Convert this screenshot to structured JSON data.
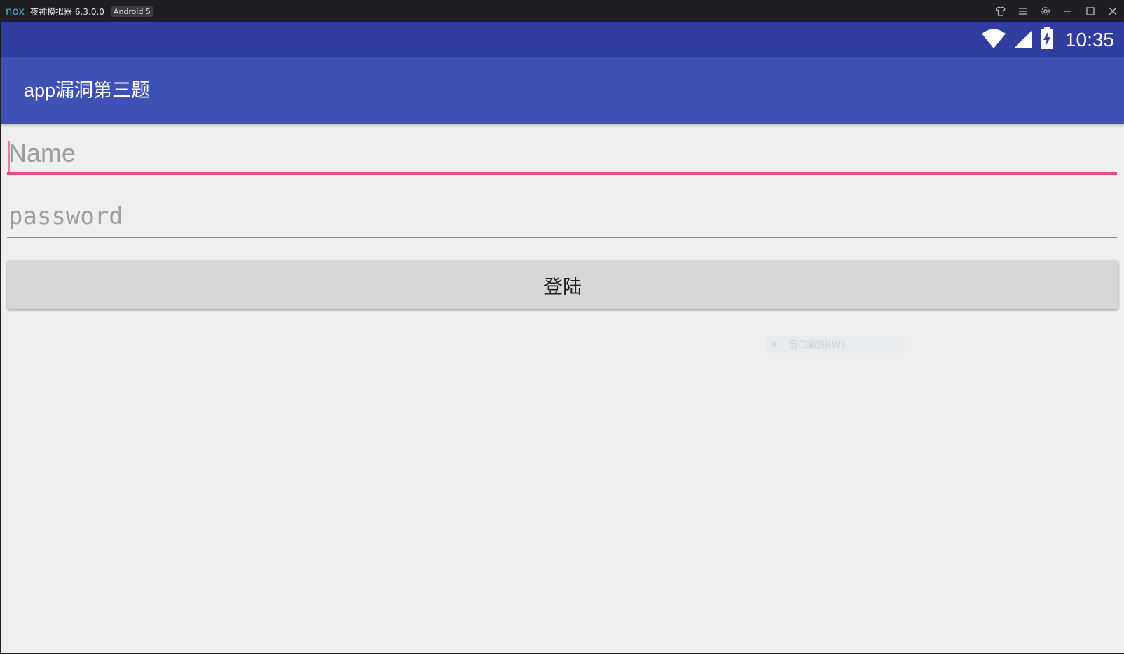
{
  "window": {
    "logo": "nox",
    "title": "夜神模拟器 6.3.0.0",
    "badge": "Android 5",
    "controls": [
      "shirt-icon",
      "menu-icon",
      "gear-icon",
      "minimize-icon",
      "maximize-icon",
      "close-icon"
    ]
  },
  "statusbar": {
    "time": "10:35",
    "icons": [
      "wifi-icon",
      "signal-icon",
      "battery-charging-icon"
    ]
  },
  "toolbar": {
    "title": "app漏洞第三题"
  },
  "form": {
    "name_placeholder": "Name",
    "password_placeholder": "password",
    "login_label": "登陆"
  },
  "tooltip": {
    "text": "窗口截图(W)"
  },
  "colors": {
    "statusbar": "#303f9f",
    "toolbar": "#3f51b5",
    "accent": "#e64f7d",
    "background": "#efefef",
    "button": "#d6d7d7"
  }
}
